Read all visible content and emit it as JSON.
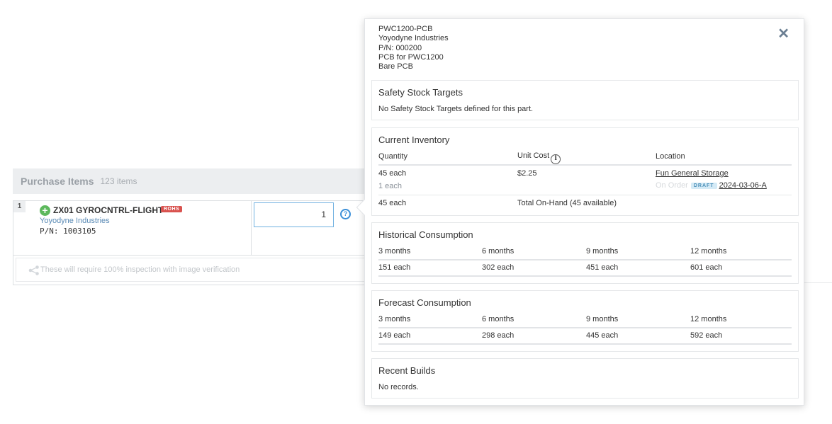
{
  "purchase_items": {
    "title": "Purchase Items",
    "count": "123 items",
    "row": {
      "number": "1",
      "name": "ZX01 GYROCNTRL-FLIGHT",
      "badge": "ROHS",
      "manufacturer": "Yoyodyne Industries",
      "part_number": "P/N: 1003105",
      "quantity": "1",
      "help_glyph": "?"
    },
    "note": "These will require 100% inspection with image verification"
  },
  "popover": {
    "close_glyph": "✕",
    "part": {
      "line1": "PWC1200-PCB",
      "line2": "Yoyodyne Industries",
      "line3": "P/N: 000200",
      "line4": "PCB for PWC1200",
      "line5": "Bare PCB"
    },
    "safety_stock": {
      "title": "Safety Stock Targets",
      "text": "No Safety Stock Targets defined for this part."
    },
    "current_inventory": {
      "title": "Current Inventory",
      "headers": {
        "quantity": "Quantity",
        "unit_cost": "Unit Cost",
        "location": "Location"
      },
      "row1": {
        "quantity": "45 each",
        "unit_cost": "$2.25",
        "location": "Fun General Storage"
      },
      "row2": {
        "quantity": "1 each",
        "on_order": "On Order",
        "draft": "DRAFT",
        "po": "2024-03-06-A"
      },
      "total": {
        "quantity": "45 each",
        "label": "Total On-Hand (45 available)"
      }
    },
    "historical": {
      "title": "Historical Consumption",
      "headers": [
        "3 months",
        "6 months",
        "9 months",
        "12 months"
      ],
      "values": [
        "151 each",
        "302 each",
        "451 each",
        "601 each"
      ]
    },
    "forecast": {
      "title": "Forecast Consumption",
      "headers": [
        "3 months",
        "6 months",
        "9 months",
        "12 months"
      ],
      "values": [
        "149 each",
        "298 each",
        "445 each",
        "592 each"
      ]
    },
    "recent_builds": {
      "title": "Recent Builds",
      "text": "No records."
    }
  },
  "colors": {
    "accent": "#3b8fd8",
    "badge_red": "#d9534f",
    "add_green": "#5cb85c",
    "draft_bg": "#d4eaf6"
  }
}
